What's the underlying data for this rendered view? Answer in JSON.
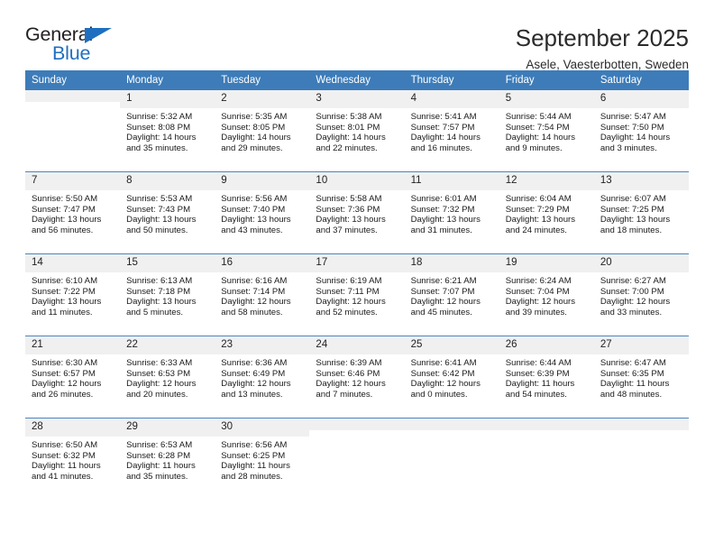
{
  "brand": {
    "name_part1": "General",
    "name_part2": "Blue"
  },
  "header": {
    "title": "September 2025",
    "subtitle": "Asele, Vaesterbotten, Sweden"
  },
  "colors": {
    "header_blue": "#3d7cb9",
    "brand_blue": "#1f6fc0",
    "daynum_background": "#f0f0f0",
    "row_divider": "#4a86c0"
  },
  "weekday_headers": [
    "Sunday",
    "Monday",
    "Tuesday",
    "Wednesday",
    "Thursday",
    "Friday",
    "Saturday"
  ],
  "labels": {
    "sunrise_prefix": "Sunrise:",
    "sunset_prefix": "Sunset:",
    "daylight_prefix": "Daylight:"
  },
  "weeks": [
    [
      {
        "day": "",
        "empty": true
      },
      {
        "day": "1",
        "line1": "Sunrise: 5:32 AM",
        "line2": "Sunset: 8:08 PM",
        "line3": "Daylight: 14 hours and 35 minutes."
      },
      {
        "day": "2",
        "line1": "Sunrise: 5:35 AM",
        "line2": "Sunset: 8:05 PM",
        "line3": "Daylight: 14 hours and 29 minutes."
      },
      {
        "day": "3",
        "line1": "Sunrise: 5:38 AM",
        "line2": "Sunset: 8:01 PM",
        "line3": "Daylight: 14 hours and 22 minutes."
      },
      {
        "day": "4",
        "line1": "Sunrise: 5:41 AM",
        "line2": "Sunset: 7:57 PM",
        "line3": "Daylight: 14 hours and 16 minutes."
      },
      {
        "day": "5",
        "line1": "Sunrise: 5:44 AM",
        "line2": "Sunset: 7:54 PM",
        "line3": "Daylight: 14 hours and 9 minutes."
      },
      {
        "day": "6",
        "line1": "Sunrise: 5:47 AM",
        "line2": "Sunset: 7:50 PM",
        "line3": "Daylight: 14 hours and 3 minutes."
      }
    ],
    [
      {
        "day": "7",
        "line1": "Sunrise: 5:50 AM",
        "line2": "Sunset: 7:47 PM",
        "line3": "Daylight: 13 hours and 56 minutes."
      },
      {
        "day": "8",
        "line1": "Sunrise: 5:53 AM",
        "line2": "Sunset: 7:43 PM",
        "line3": "Daylight: 13 hours and 50 minutes."
      },
      {
        "day": "9",
        "line1": "Sunrise: 5:56 AM",
        "line2": "Sunset: 7:40 PM",
        "line3": "Daylight: 13 hours and 43 minutes."
      },
      {
        "day": "10",
        "line1": "Sunrise: 5:58 AM",
        "line2": "Sunset: 7:36 PM",
        "line3": "Daylight: 13 hours and 37 minutes."
      },
      {
        "day": "11",
        "line1": "Sunrise: 6:01 AM",
        "line2": "Sunset: 7:32 PM",
        "line3": "Daylight: 13 hours and 31 minutes."
      },
      {
        "day": "12",
        "line1": "Sunrise: 6:04 AM",
        "line2": "Sunset: 7:29 PM",
        "line3": "Daylight: 13 hours and 24 minutes."
      },
      {
        "day": "13",
        "line1": "Sunrise: 6:07 AM",
        "line2": "Sunset: 7:25 PM",
        "line3": "Daylight: 13 hours and 18 minutes."
      }
    ],
    [
      {
        "day": "14",
        "line1": "Sunrise: 6:10 AM",
        "line2": "Sunset: 7:22 PM",
        "line3": "Daylight: 13 hours and 11 minutes."
      },
      {
        "day": "15",
        "line1": "Sunrise: 6:13 AM",
        "line2": "Sunset: 7:18 PM",
        "line3": "Daylight: 13 hours and 5 minutes."
      },
      {
        "day": "16",
        "line1": "Sunrise: 6:16 AM",
        "line2": "Sunset: 7:14 PM",
        "line3": "Daylight: 12 hours and 58 minutes."
      },
      {
        "day": "17",
        "line1": "Sunrise: 6:19 AM",
        "line2": "Sunset: 7:11 PM",
        "line3": "Daylight: 12 hours and 52 minutes."
      },
      {
        "day": "18",
        "line1": "Sunrise: 6:21 AM",
        "line2": "Sunset: 7:07 PM",
        "line3": "Daylight: 12 hours and 45 minutes."
      },
      {
        "day": "19",
        "line1": "Sunrise: 6:24 AM",
        "line2": "Sunset: 7:04 PM",
        "line3": "Daylight: 12 hours and 39 minutes."
      },
      {
        "day": "20",
        "line1": "Sunrise: 6:27 AM",
        "line2": "Sunset: 7:00 PM",
        "line3": "Daylight: 12 hours and 33 minutes."
      }
    ],
    [
      {
        "day": "21",
        "line1": "Sunrise: 6:30 AM",
        "line2": "Sunset: 6:57 PM",
        "line3": "Daylight: 12 hours and 26 minutes."
      },
      {
        "day": "22",
        "line1": "Sunrise: 6:33 AM",
        "line2": "Sunset: 6:53 PM",
        "line3": "Daylight: 12 hours and 20 minutes."
      },
      {
        "day": "23",
        "line1": "Sunrise: 6:36 AM",
        "line2": "Sunset: 6:49 PM",
        "line3": "Daylight: 12 hours and 13 minutes."
      },
      {
        "day": "24",
        "line1": "Sunrise: 6:39 AM",
        "line2": "Sunset: 6:46 PM",
        "line3": "Daylight: 12 hours and 7 minutes."
      },
      {
        "day": "25",
        "line1": "Sunrise: 6:41 AM",
        "line2": "Sunset: 6:42 PM",
        "line3": "Daylight: 12 hours and 0 minutes."
      },
      {
        "day": "26",
        "line1": "Sunrise: 6:44 AM",
        "line2": "Sunset: 6:39 PM",
        "line3": "Daylight: 11 hours and 54 minutes."
      },
      {
        "day": "27",
        "line1": "Sunrise: 6:47 AM",
        "line2": "Sunset: 6:35 PM",
        "line3": "Daylight: 11 hours and 48 minutes."
      }
    ],
    [
      {
        "day": "28",
        "line1": "Sunrise: 6:50 AM",
        "line2": "Sunset: 6:32 PM",
        "line3": "Daylight: 11 hours and 41 minutes."
      },
      {
        "day": "29",
        "line1": "Sunrise: 6:53 AM",
        "line2": "Sunset: 6:28 PM",
        "line3": "Daylight: 11 hours and 35 minutes."
      },
      {
        "day": "30",
        "line1": "Sunrise: 6:56 AM",
        "line2": "Sunset: 6:25 PM",
        "line3": "Daylight: 11 hours and 28 minutes."
      },
      {
        "day": "",
        "empty": true
      },
      {
        "day": "",
        "empty": true
      },
      {
        "day": "",
        "empty": true
      },
      {
        "day": "",
        "empty": true
      }
    ]
  ]
}
